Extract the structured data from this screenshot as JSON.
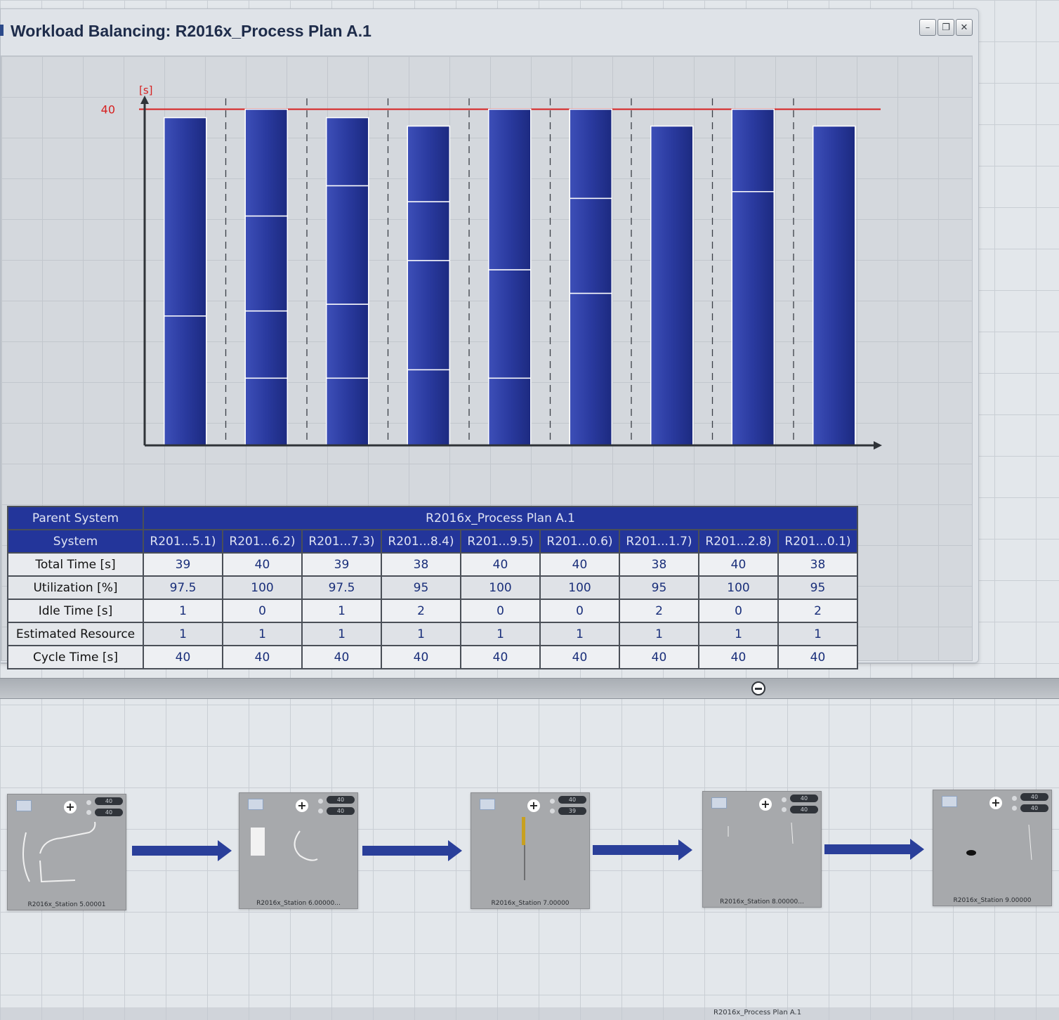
{
  "window": {
    "title": "Workload Balancing: R2016x_Process Plan A.1",
    "buttons": [
      "minimize",
      "restore",
      "close"
    ]
  },
  "chart_data": {
    "type": "bar",
    "stacked": true,
    "ylabel": "[s]",
    "cycle_time_line": 40,
    "cycle_time_label": "40",
    "line_color": "#d62020",
    "bar_color": "#2a3a9f",
    "ylim": [
      0,
      41.3
    ],
    "categories": [
      "R201...5.1)",
      "R201...6.2)",
      "R201...7.3)",
      "R201...8.4)",
      "R201...9.5)",
      "R201...0.6)",
      "R201...1.7)",
      "R201...2.8)",
      "R201...0.1)"
    ],
    "totals": [
      39,
      40,
      39,
      38,
      40,
      40,
      38,
      40,
      38
    ],
    "segments": [
      [
        15.4,
        23.6
      ],
      [
        8.0,
        8.0,
        11.3,
        12.7
      ],
      [
        8.0,
        8.8,
        14.1,
        8.1
      ],
      [
        9.0,
        13.0,
        7.0,
        9.0
      ],
      [
        8.0,
        12.9,
        19.1
      ],
      [
        18.1,
        11.3,
        10.6
      ],
      [
        38
      ],
      [
        30.2,
        9.8
      ],
      [
        38
      ]
    ],
    "grid": true
  },
  "table": {
    "parent_label": "Parent System",
    "parent_value": "R2016x_Process Plan A.1",
    "system_label": "System",
    "systems": [
      "R201...5.1)",
      "R201...6.2)",
      "R201...7.3)",
      "R201...8.4)",
      "R201...9.5)",
      "R201...0.6)",
      "R201...1.7)",
      "R201...2.8)",
      "R201...0.1)"
    ],
    "rows": [
      {
        "label": "Total Time [s]",
        "values": [
          "39",
          "40",
          "39",
          "38",
          "40",
          "40",
          "38",
          "40",
          "38"
        ]
      },
      {
        "label": "Utilization [%]",
        "values": [
          "97.5",
          "100",
          "97.5",
          "95",
          "100",
          "100",
          "95",
          "100",
          "95"
        ]
      },
      {
        "label": "Idle Time [s]",
        "values": [
          "1",
          "0",
          "1",
          "2",
          "0",
          "0",
          "2",
          "0",
          "2"
        ]
      },
      {
        "label": "Estimated Resource",
        "values": [
          "1",
          "1",
          "1",
          "1",
          "1",
          "1",
          "1",
          "1",
          "1"
        ]
      },
      {
        "label": "Cycle Time [s]",
        "values": [
          "40",
          "40",
          "40",
          "40",
          "40",
          "40",
          "40",
          "40",
          "40"
        ]
      }
    ]
  },
  "flow": {
    "stations": [
      {
        "label": "R2016x_Station 5.00001",
        "badge_top": "40",
        "badge_bottom": "40"
      },
      {
        "label": "R2016x_Station 6.00000...",
        "badge_top": "40",
        "badge_bottom": "40"
      },
      {
        "label": "R2016x_Station 7.00000",
        "badge_top": "40",
        "badge_bottom": "39"
      },
      {
        "label": "R2016x_Station 8.00000...",
        "badge_top": "40",
        "badge_bottom": "40"
      },
      {
        "label": "R2016x_Station 9.00000",
        "badge_top": "40",
        "badge_bottom": "40"
      }
    ],
    "footer_label": "R2016x_Process Plan A.1"
  }
}
